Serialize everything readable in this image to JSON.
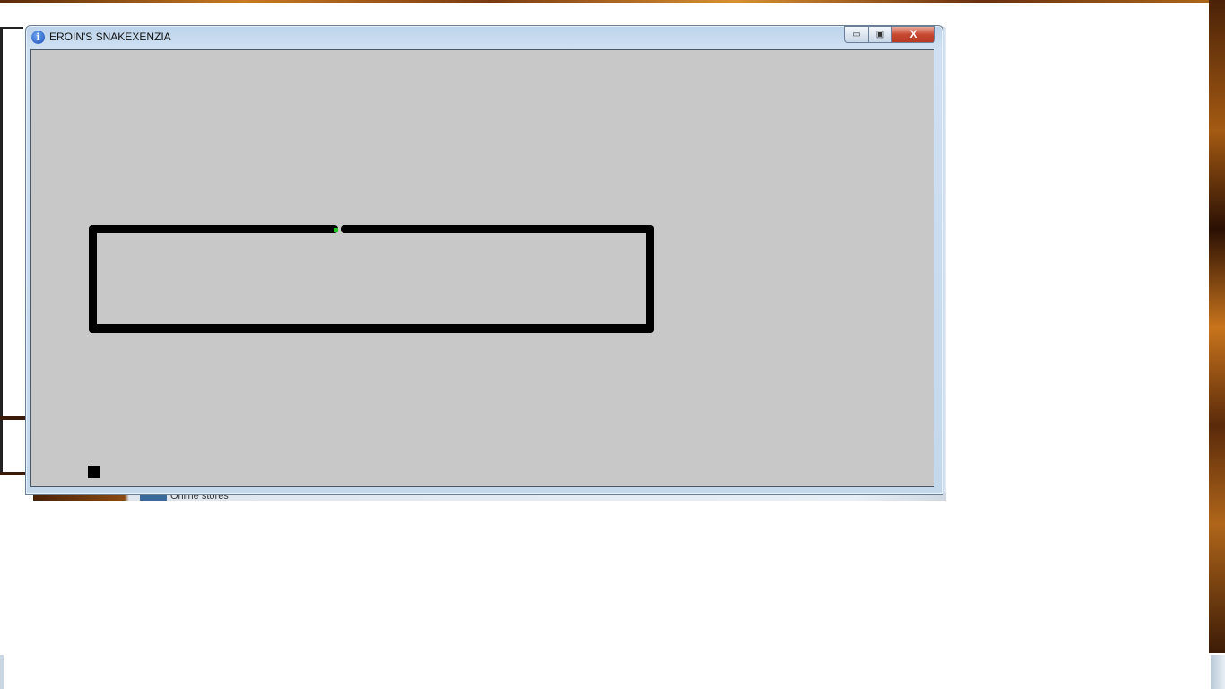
{
  "window": {
    "title": "EROIN'S SNAKEXENZIA",
    "icon": "info-icon",
    "icon_glyph": "i",
    "controls": {
      "minimize_glyph": "▭",
      "maximize_glyph": "▣",
      "close_glyph": "X"
    }
  },
  "background": {
    "taskbar_item_text": "Online stores"
  },
  "game": {
    "background_color": "#c8c8c8",
    "snake_color": "#000000",
    "head_color": "#1ec81e",
    "food_color": "#000000"
  }
}
